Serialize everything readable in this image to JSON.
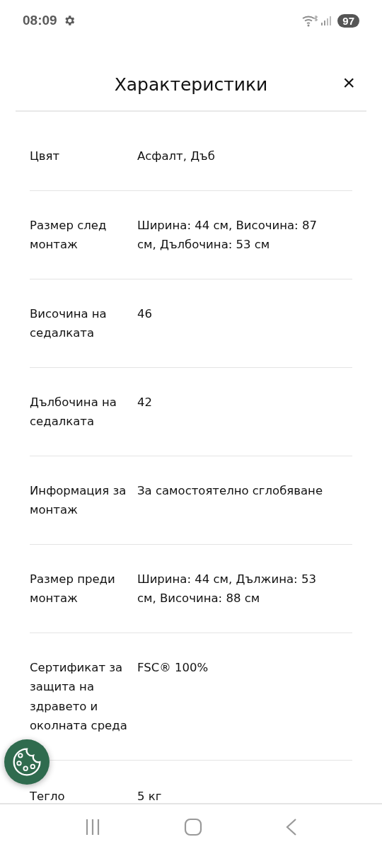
{
  "status_bar": {
    "time": "08:09",
    "battery": "97"
  },
  "header": {
    "title": "Характеристики",
    "close": "×"
  },
  "specs": [
    {
      "label": "Цвят",
      "value": "Асфалт, Дъб"
    },
    {
      "label": "Размер след монтаж",
      "value": "Ширина: 44 см, Височина: 87 см, Дълбочина: 53 см"
    },
    {
      "label": "Височина на седалката",
      "value": "46"
    },
    {
      "label": "Дълбочина на седалката",
      "value": "42"
    },
    {
      "label": "Информация за монтаж",
      "value": "За самостоятелно сглобяване"
    },
    {
      "label": "Размер преди монтаж",
      "value": "Ширина: 44 см, Дължина: 53 см, Височина: 88 см"
    },
    {
      "label": "Сертификат за защита на здравето и околната среда",
      "value": "FSC® 100%"
    },
    {
      "label": "Тегло",
      "value": "5 кг"
    }
  ]
}
